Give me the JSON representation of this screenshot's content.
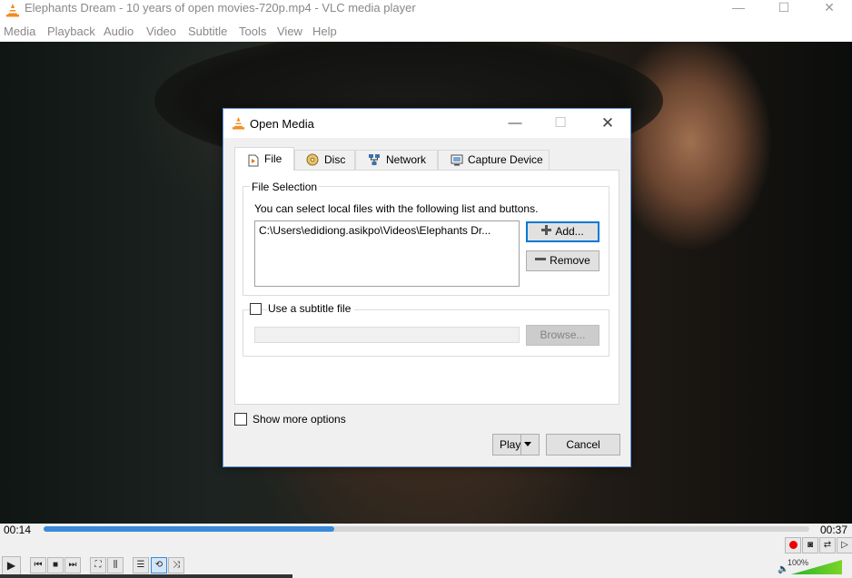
{
  "window": {
    "title": "Elephants Dream - 10 years of open movies-720p.mp4 - VLC media player",
    "minimize_glyph": "—",
    "maximize_glyph": "☐",
    "close_glyph": "✕"
  },
  "menu": {
    "items": [
      "Media",
      "Playback",
      "Audio",
      "Video",
      "Subtitle",
      "Tools",
      "View",
      "Help"
    ]
  },
  "dialog": {
    "title": "Open Media",
    "minimize_glyph": "—",
    "maximize_glyph": "☐",
    "close_glyph": "✕",
    "tabs": [
      {
        "label": "File",
        "icon": "file-icon",
        "active": true
      },
      {
        "label": "Disc",
        "icon": "disc-icon",
        "active": false
      },
      {
        "label": "Network",
        "icon": "network-icon",
        "active": false
      },
      {
        "label": "Capture Device",
        "icon": "capture-device-icon",
        "active": false
      }
    ],
    "file_selection": {
      "title": "File Selection",
      "description": "You can select local files with the following list and buttons.",
      "files": [
        "C:\\Users\\edidiong.asikpo\\Videos\\Elephants Dr..."
      ],
      "add_label": "Add...",
      "remove_label": "Remove"
    },
    "subtitle": {
      "checkbox_label": "Use a subtitle file",
      "checked": false,
      "path_value": "",
      "browse_label": "Browse..."
    },
    "show_more": {
      "label": "Show more options",
      "checked": false
    },
    "play_label": "Play",
    "cancel_label": "Cancel"
  },
  "player": {
    "time_current": "00:14",
    "time_total": "00:37",
    "progress_fraction": 0.38,
    "volume_label": "100%",
    "volume_fraction": 1.0,
    "accent_color": "#3a8ad9"
  }
}
